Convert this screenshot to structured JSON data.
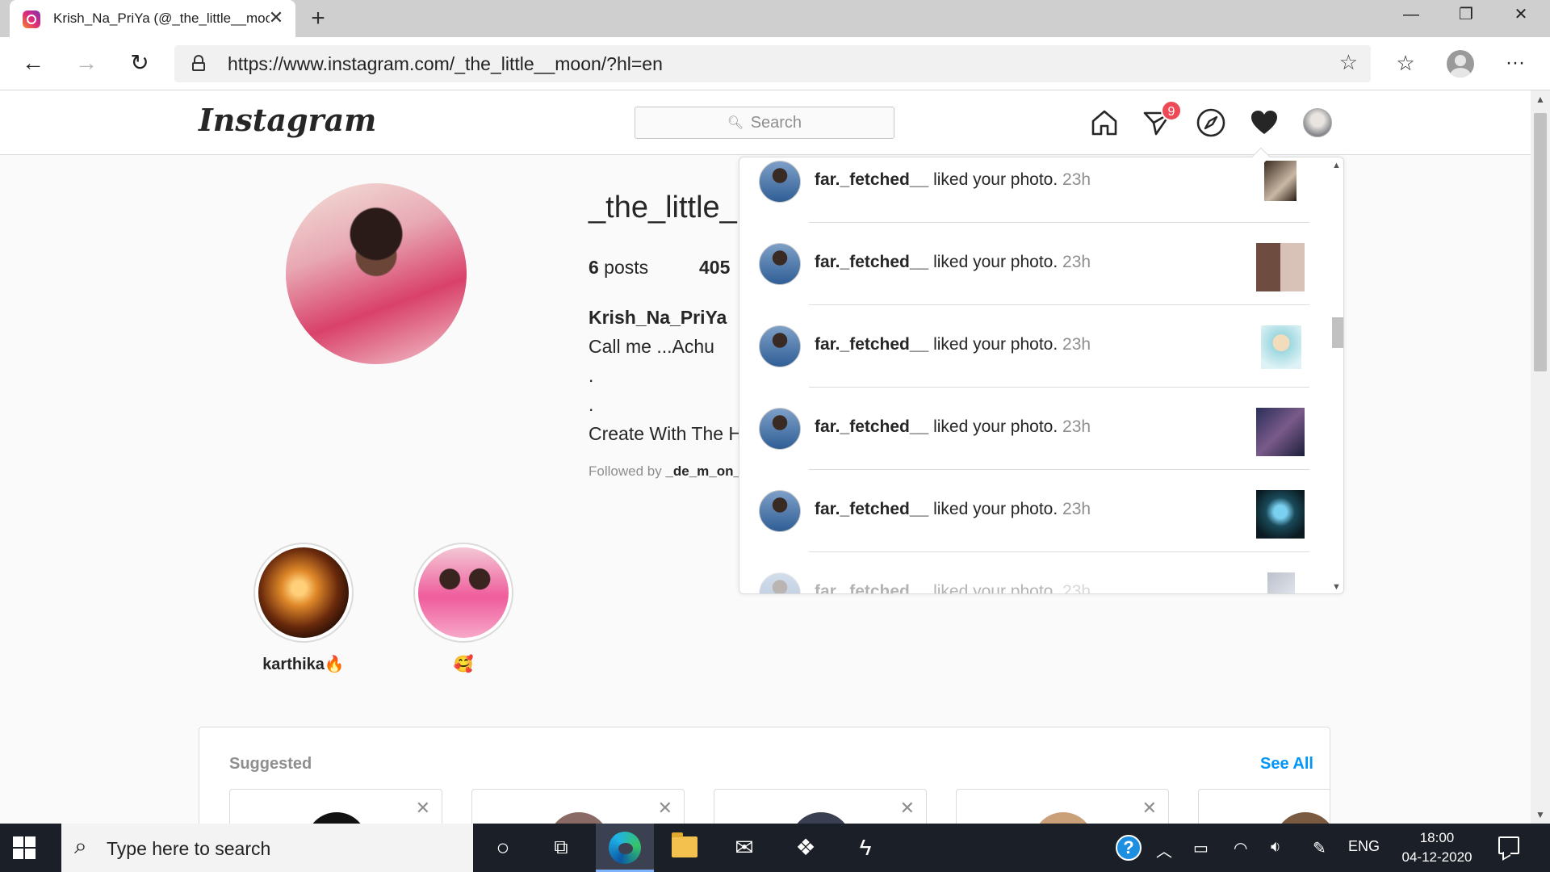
{
  "browser": {
    "tab_title": "Krish_Na_PriYa (@_the_little__moon)",
    "url": "https://www.instagram.com/_the_little__moon/?hl=en",
    "icons": {
      "back": "arrow-left-icon",
      "forward": "arrow-right-icon",
      "refresh": "refresh-icon",
      "favorites": "star-icon",
      "collections": "collections-icon",
      "menu": "more-icon"
    }
  },
  "instagram": {
    "logo": "Instagram",
    "search_placeholder": "Search",
    "dm_badge": "9"
  },
  "profile": {
    "username": "_the_little_",
    "posts_number": "6",
    "posts_label": " posts",
    "followers_partial": "405",
    "full_name": "Krish_Na_PriYa",
    "bio": [
      "Call me ...Achu",
      ".",
      ".",
      "Create With The H"
    ],
    "followed_by_label": "Followed by ",
    "followed_by_user": "_de_m_on_"
  },
  "highlights": [
    {
      "label": "karthika🔥"
    },
    {
      "label": "🥰"
    }
  ],
  "suggested": {
    "title": "Suggested",
    "see_all": "See All"
  },
  "activity": [
    {
      "user": "far._fetched__",
      "action": " liked your photo. ",
      "time": "23h"
    },
    {
      "user": "far._fetched__",
      "action": " liked your photo. ",
      "time": "23h"
    },
    {
      "user": "far._fetched__",
      "action": " liked your photo. ",
      "time": "23h"
    },
    {
      "user": "far._fetched__",
      "action": " liked your photo. ",
      "time": "23h"
    },
    {
      "user": "far._fetched__",
      "action": " liked your photo. ",
      "time": "23h"
    },
    {
      "user": "far._fetched__",
      "action": " liked your photo. ",
      "time": "23h"
    }
  ],
  "taskbar": {
    "search_placeholder": "Type here to search",
    "language": "ENG",
    "time": "18:00",
    "date": "04-12-2020"
  },
  "colors": {
    "instagram_blue": "#0095f6",
    "badge_red": "#ed4956",
    "taskbar_bg": "#1b1f27"
  }
}
